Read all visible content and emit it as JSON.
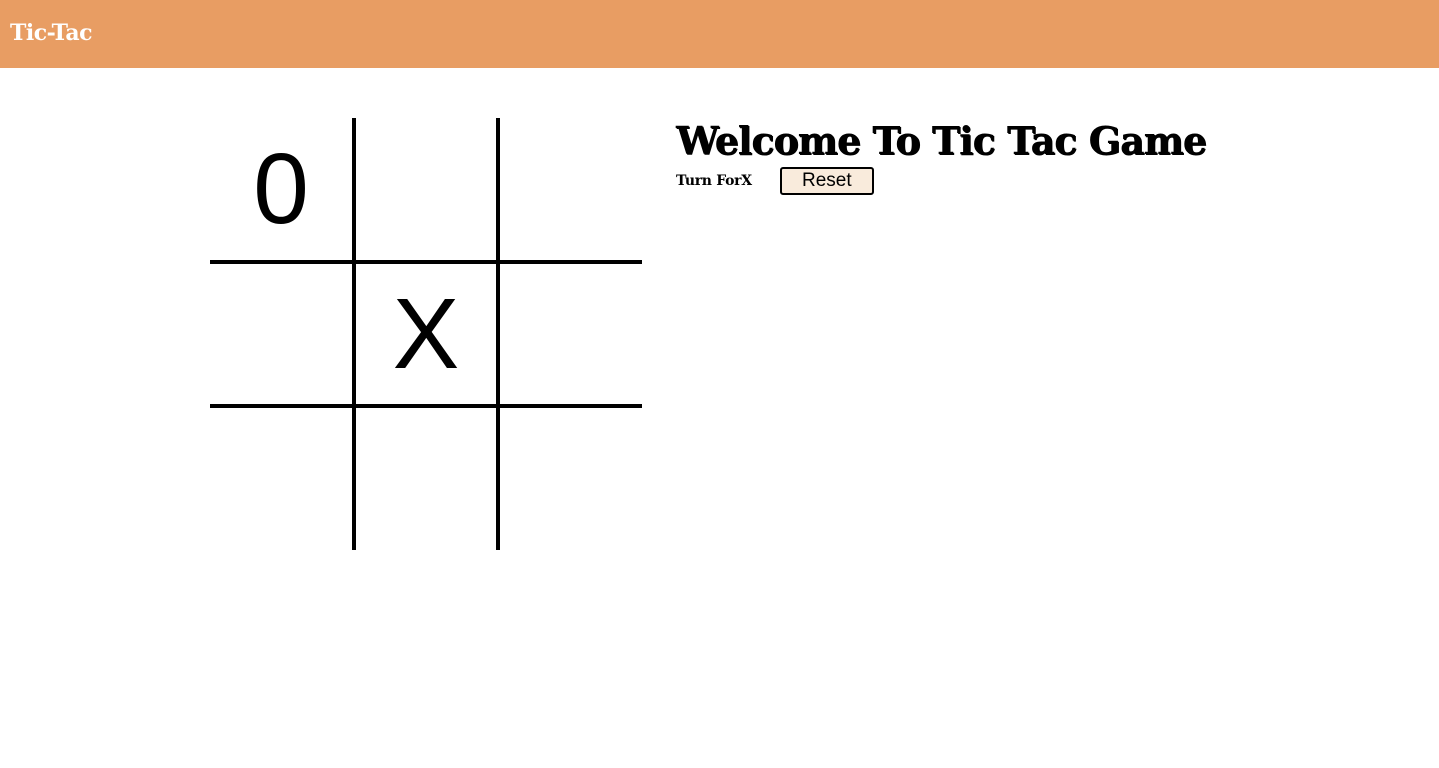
{
  "header": {
    "brand": "Tic-Tac",
    "background_color": "#e89d63",
    "text_color": "#ffffff"
  },
  "board": {
    "cells": [
      "0",
      "",
      "",
      "",
      "X",
      "",
      "",
      "",
      ""
    ]
  },
  "info": {
    "title": "Welcome To Tic Tac Game",
    "turn_prefix": "Turn For",
    "turn_player": "X",
    "reset_label": "Reset",
    "reset_bg": "#f9ebdc"
  }
}
